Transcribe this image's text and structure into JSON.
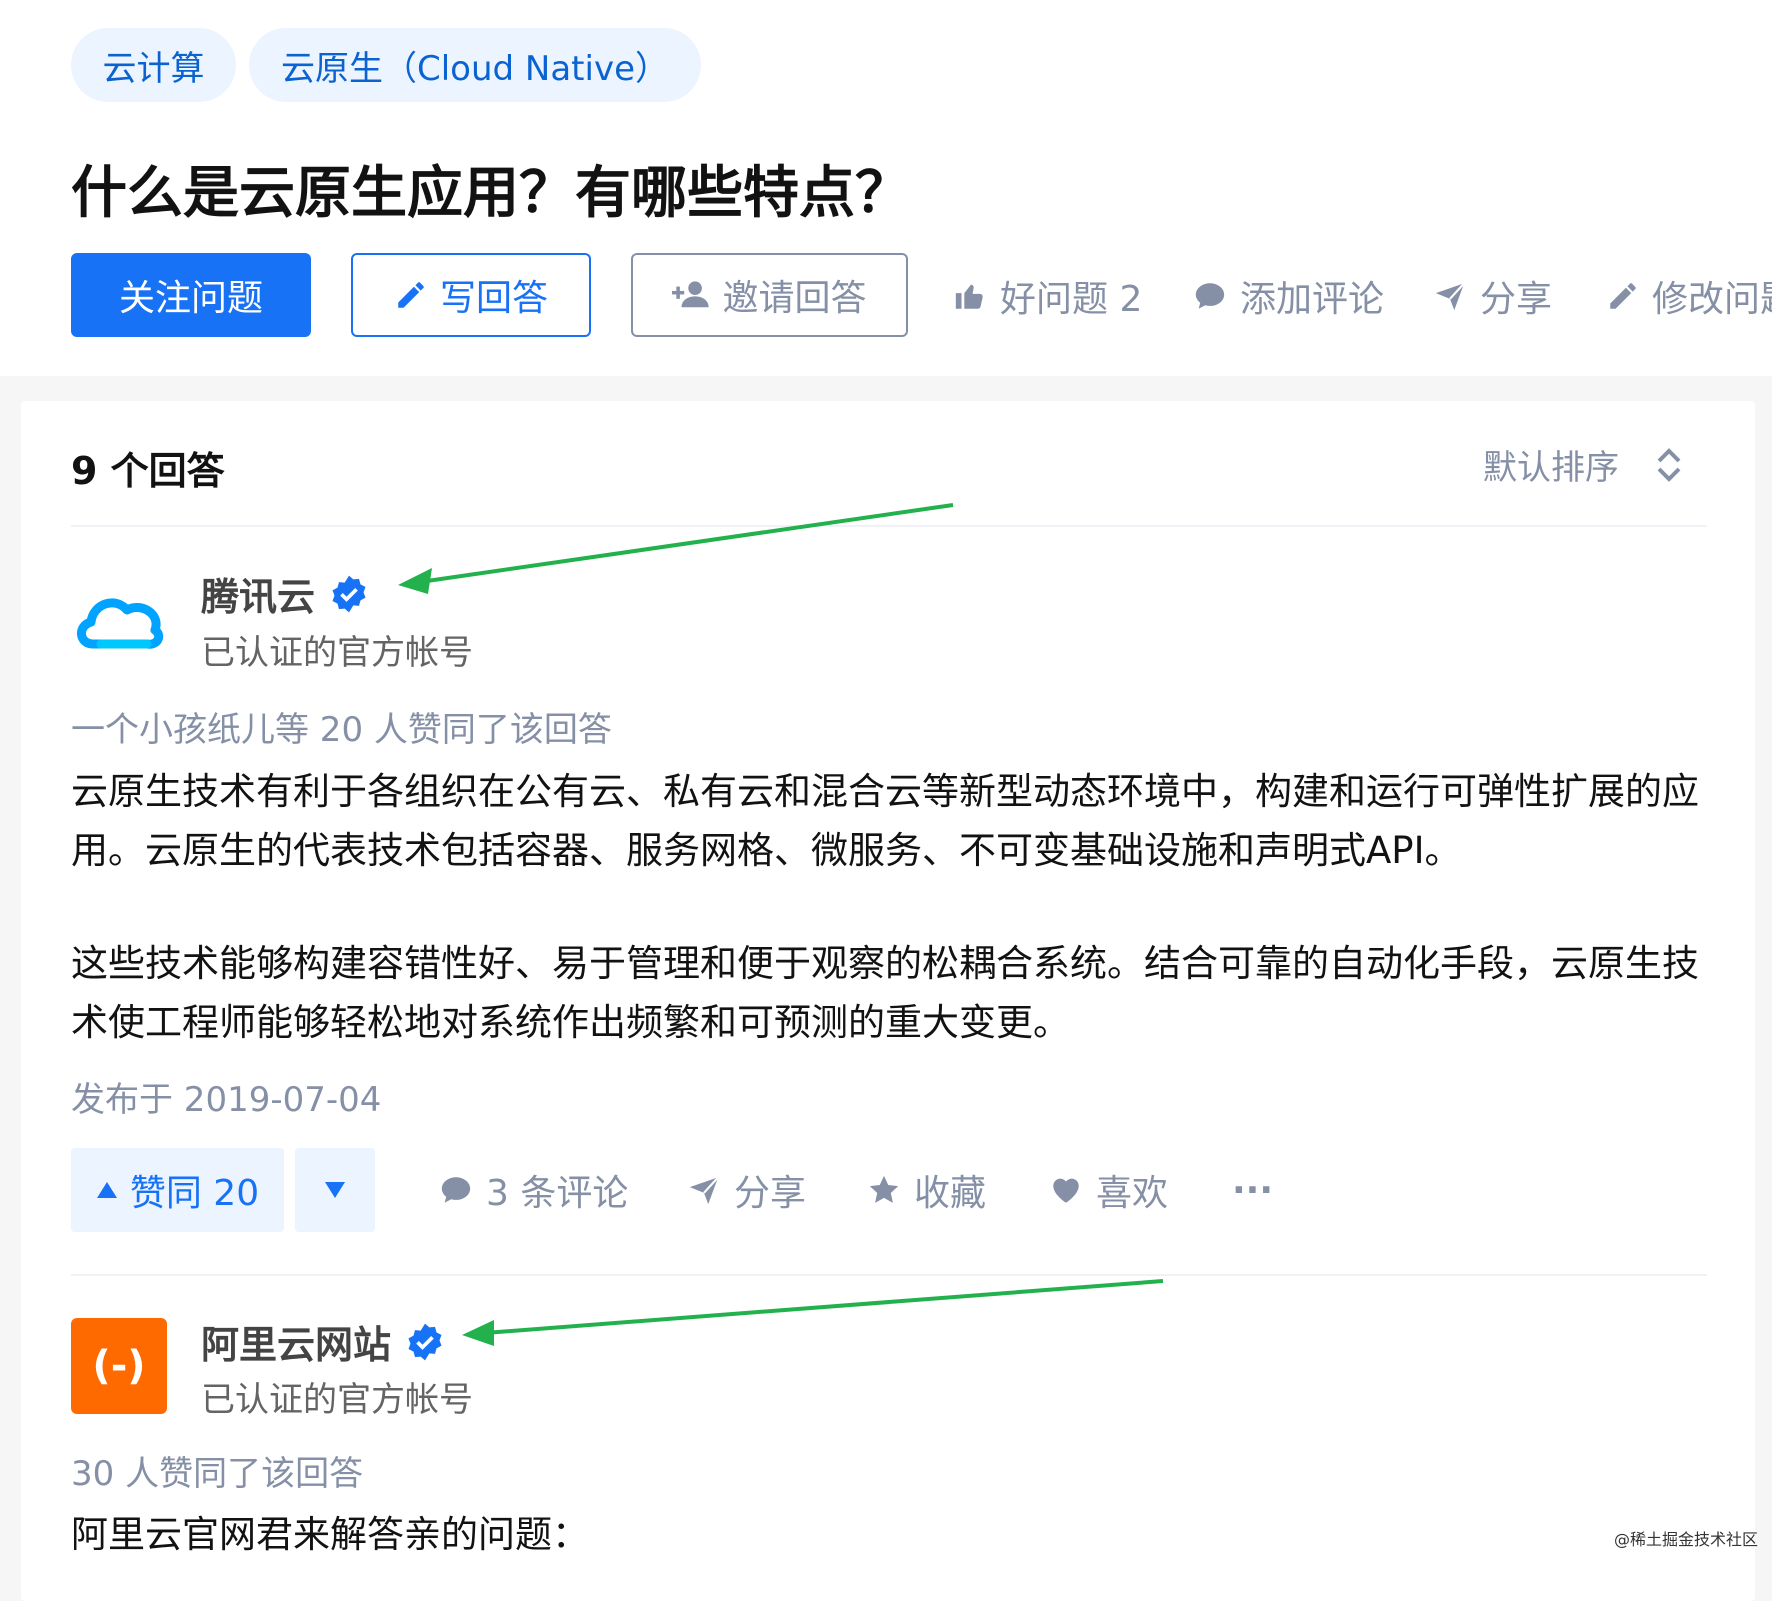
{
  "tags": [
    "云计算",
    "云原生（Cloud Native）"
  ],
  "question": {
    "title": "什么是云原生应用？有哪些特点？",
    "follow_label": "关注问题",
    "write_label": "写回答",
    "invite_label": "邀请回答",
    "good_question_label": "好问题 2",
    "add_comment_label": "添加评论",
    "share_label": "分享",
    "edit_label": "修改问题"
  },
  "answers_header": {
    "count_label": "9 个回答",
    "sort_label": "默认排序"
  },
  "answers": [
    {
      "author": "腾讯云",
      "author_sub": "已认证的官方帐号",
      "voters": "一个小孩纸儿等 20 人赞同了该回答",
      "paragraphs": [
        "云原生技术有利于各组织在公有云、私有云和混合云等新型动态环境中，构建和运行可弹性扩展的应用。云原生的代表技术包括容器、服务网格、微服务、不可变基础设施和声明式API。",
        "这些技术能够构建容错性好、易于管理和便于观察的松耦合系统。结合可靠的自动化手段，云原生技术使工程师能够轻松地对系统作出频繁和可预测的重大变更。"
      ],
      "date": "发布于 2019-07-04",
      "vote_label": "赞同 20",
      "comments_label": "3 条评论",
      "share_label": "分享",
      "collect_label": "收藏",
      "like_label": "喜欢",
      "more_label": "···",
      "avatar_color": "#00a3ff"
    },
    {
      "author": "阿里云网站",
      "author_sub": "已认证的官方帐号",
      "voters": "30 人赞同了该回答",
      "paragraphs": [
        "阿里云官网君来解答亲的问题："
      ],
      "avatar_color": "#ff6a00",
      "logo_text": "(-)"
    }
  ],
  "watermark": "@稀土掘金技术社区",
  "colors": {
    "primary": "#1772f6",
    "muted": "#8590a6",
    "verified": "#1772f6",
    "annotation_arrow": "#22b14c"
  }
}
